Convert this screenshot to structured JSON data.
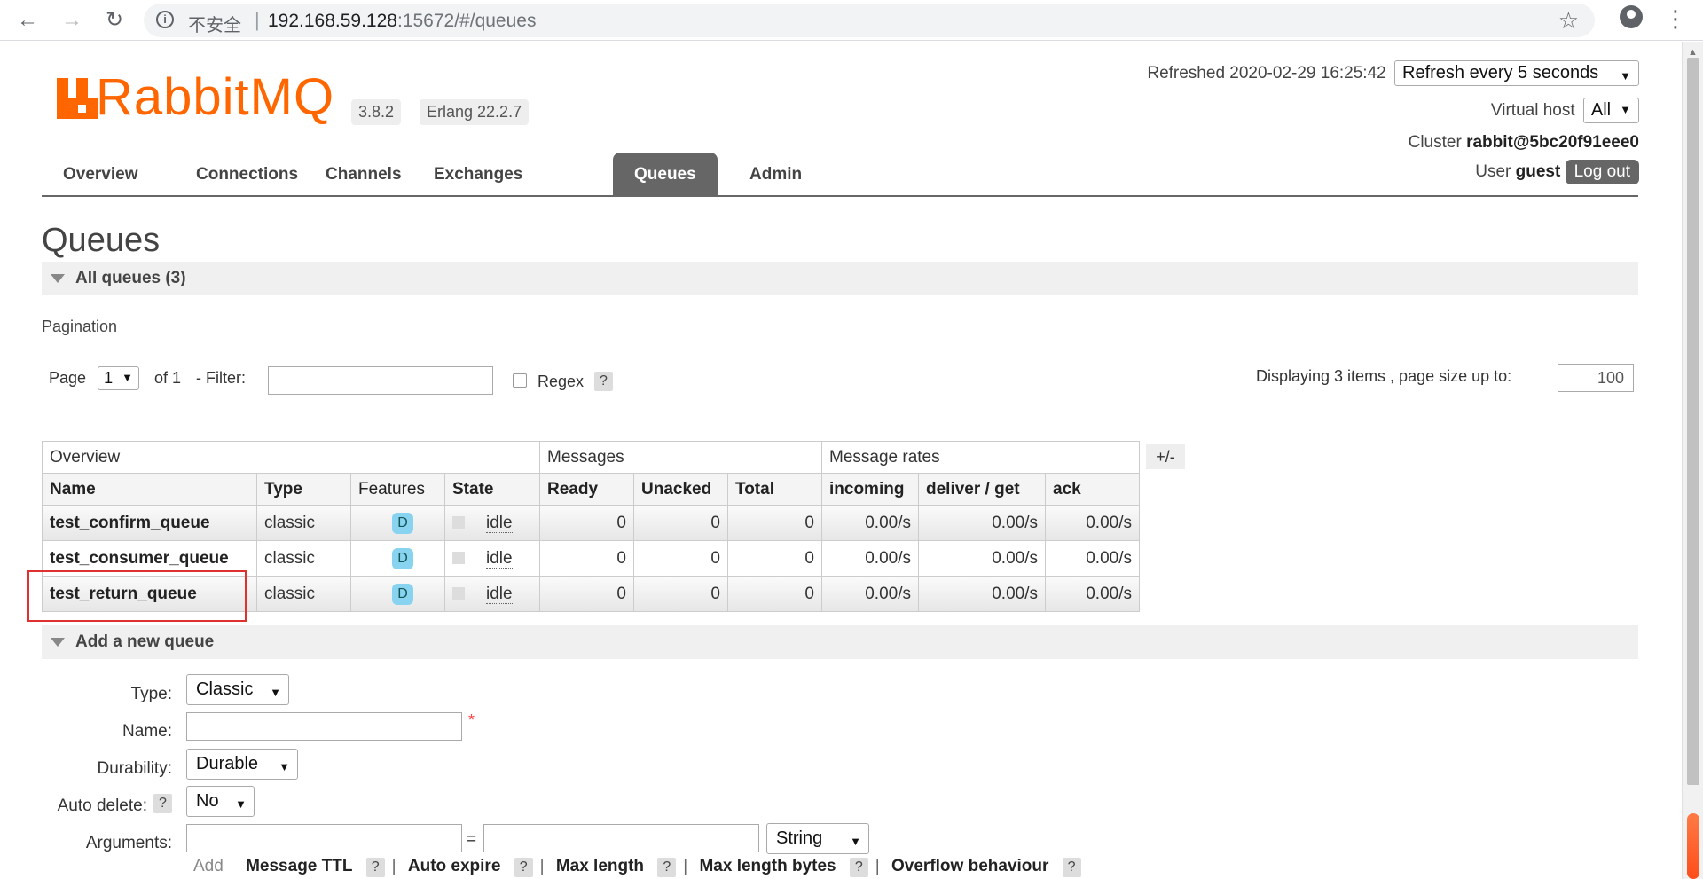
{
  "browser": {
    "back": "←",
    "forward": "→",
    "reload": "↻",
    "security_label": "不安全",
    "url_host": "192.168.59.128",
    "url_rest": ":15672/#/queues",
    "star": "☆",
    "menu": "⋮"
  },
  "app": {
    "logo_text": "RabbitMQ",
    "version": "3.8.2",
    "erlang": "Erlang 22.2.7",
    "refreshed": "Refreshed 2020-02-29 16:25:42",
    "refresh_select": "Refresh every 5 seconds",
    "vhost_label": "Virtual host",
    "vhost_value": "All",
    "cluster_label": "Cluster",
    "cluster_value": "rabbit@5bc20f91eee0",
    "user_label": "User",
    "user_value": "guest",
    "logout": "Log out"
  },
  "tabs": [
    {
      "label": "Overview"
    },
    {
      "label": "Connections"
    },
    {
      "label": "Channels"
    },
    {
      "label": "Exchanges"
    },
    {
      "label": "Queues"
    },
    {
      "label": "Admin"
    }
  ],
  "page_title": "Queues",
  "all_queues": "All queues (3)",
  "pagination": {
    "label": "Pagination",
    "page_label": "Page",
    "page_value": "1",
    "of_label": "of 1",
    "filter_label": "- Filter:",
    "regex_label": "Regex",
    "help": "?",
    "displaying": "Displaying 3 items , page size up to:",
    "page_size": "100"
  },
  "table": {
    "groups": [
      "Overview",
      "Messages",
      "Message rates"
    ],
    "columns": [
      "Name",
      "Type",
      "Features",
      "State",
      "Ready",
      "Unacked",
      "Total",
      "incoming",
      "deliver / get",
      "ack"
    ],
    "toggle": "+/-",
    "rows": [
      {
        "name": "test_confirm_queue",
        "type": "classic",
        "feature": "D",
        "state": "idle",
        "ready": "0",
        "unacked": "0",
        "total": "0",
        "incoming": "0.00/s",
        "deliver": "0.00/s",
        "ack": "0.00/s"
      },
      {
        "name": "test_consumer_queue",
        "type": "classic",
        "feature": "D",
        "state": "idle",
        "ready": "0",
        "unacked": "0",
        "total": "0",
        "incoming": "0.00/s",
        "deliver": "0.00/s",
        "ack": "0.00/s"
      },
      {
        "name": "test_return_queue",
        "type": "classic",
        "feature": "D",
        "state": "idle",
        "ready": "0",
        "unacked": "0",
        "total": "0",
        "incoming": "0.00/s",
        "deliver": "0.00/s",
        "ack": "0.00/s"
      }
    ]
  },
  "add_queue": {
    "title": "Add a new queue",
    "type_label": "Type:",
    "type_value": "Classic",
    "name_label": "Name:",
    "required": "*",
    "durability_label": "Durability:",
    "durability_value": "Durable",
    "autodelete_label": "Auto delete:",
    "autodelete_value": "No",
    "arguments_label": "Arguments:",
    "equals": "=",
    "arg_type_value": "String",
    "add_label": "Add",
    "arg_links": [
      "Message TTL",
      "Auto expire",
      "Max length",
      "Max length bytes",
      "Overflow behaviour"
    ]
  },
  "colors": {
    "brand": "#ff6600",
    "tab_active": "#666666",
    "highlight_box": "#e03030"
  }
}
